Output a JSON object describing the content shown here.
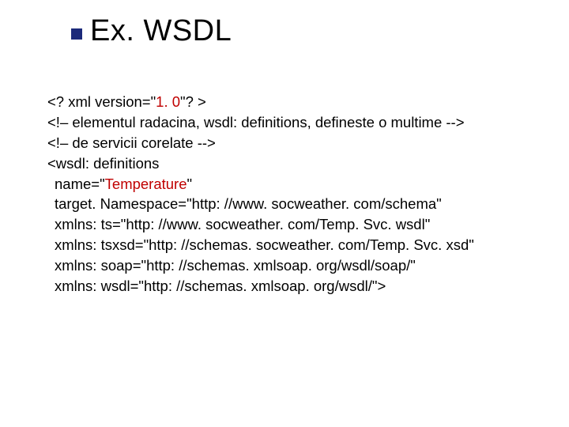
{
  "title": "Ex. WSDL",
  "lines": {
    "l1a": "<? xml version=\"",
    "l1b": "1. 0",
    "l1c": "\"? >",
    "l2": "<!– elementul radacina, wsdl: definitions, defineste o multime -->",
    "l3": "<!– de servicii corelate -->",
    "l4": "<wsdl: definitions",
    "l5a": "name=\"",
    "l5b": "Temperature",
    "l5c": "\"",
    "l6": "target. Namespace=\"http: //www. socweather. com/schema\"",
    "l7": "xmlns: ts=\"http: //www. socweather. com/Temp. Svc. wsdl\"",
    "l8": "xmlns: tsxsd=\"http: //schemas. socweather. com/Temp. Svc. xsd\"",
    "l9": "xmlns: soap=\"http: //schemas. xmlsoap. org/wsdl/soap/\"",
    "l10": "xmlns: wsdl=\"http: //schemas. xmlsoap. org/wsdl/\">"
  }
}
